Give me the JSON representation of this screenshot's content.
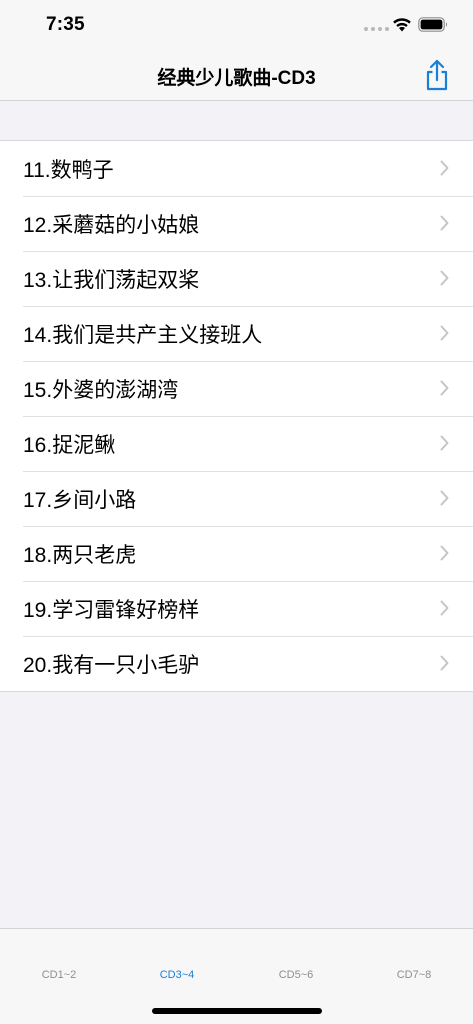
{
  "status": {
    "time": "7:35"
  },
  "nav": {
    "title": "经典少儿歌曲-CD3",
    "share_icon": "share-icon"
  },
  "songs": [
    "11.数鸭子",
    "12.采蘑菇的小姑娘",
    "13.让我们荡起双桨",
    "14.我们是共产主义接班人",
    "15.外婆的澎湖湾",
    "16.捉泥鳅",
    "17.乡间小路",
    "18.两只老虎",
    "19.学习雷锋好榜样",
    "20.我有一只小毛驴"
  ],
  "tabs": [
    {
      "label": "CD1~2",
      "active": false
    },
    {
      "label": "CD3~4",
      "active": true
    },
    {
      "label": "CD5~6",
      "active": false
    },
    {
      "label": "CD7~8",
      "active": false
    }
  ],
  "colors": {
    "accent": "#1a7fd6",
    "inactive_tab": "#8e8e93",
    "background": "#f2f2f7"
  }
}
